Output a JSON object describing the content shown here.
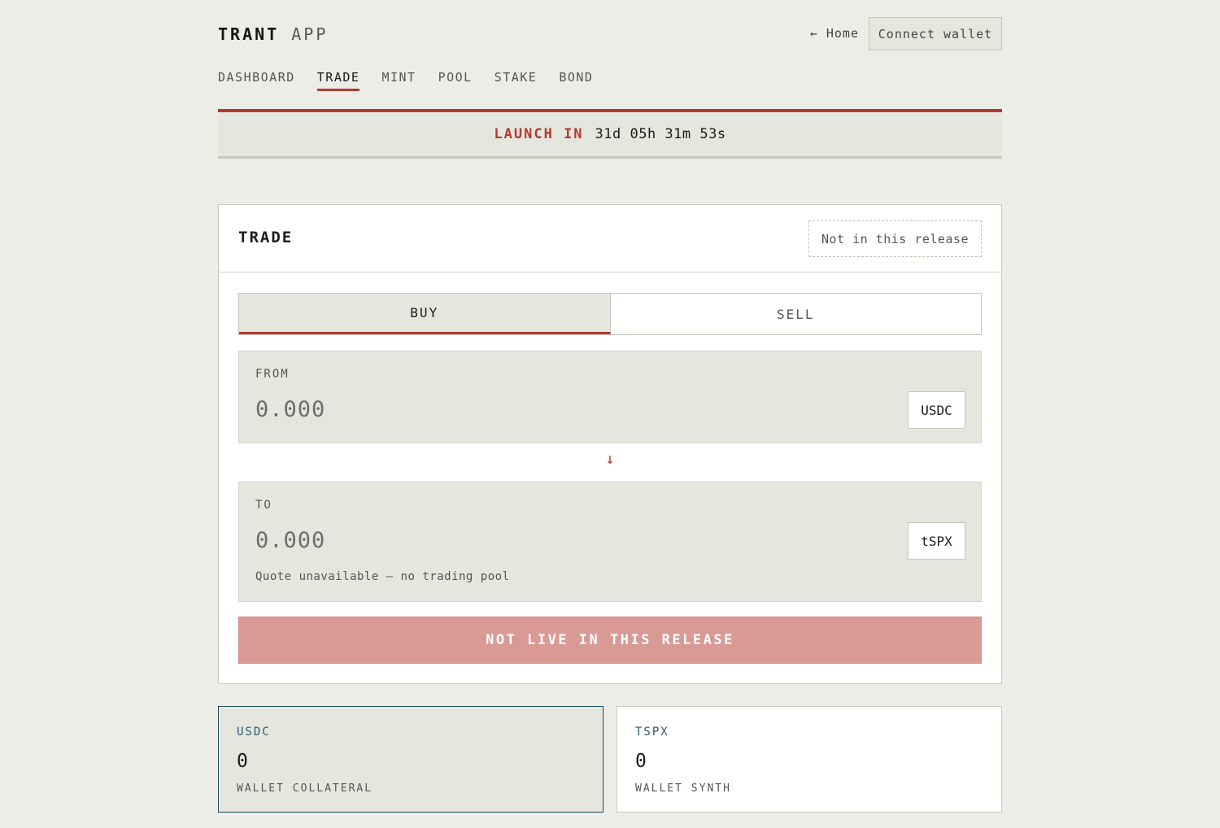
{
  "header": {
    "brand_primary": "TRANT",
    "brand_secondary": "APP",
    "home_link": "← Home",
    "connect_wallet": "Connect wallet"
  },
  "nav": {
    "items": [
      {
        "label": "DASHBOARD"
      },
      {
        "label": "TRADE",
        "active": true
      },
      {
        "label": "MINT"
      },
      {
        "label": "POOL"
      },
      {
        "label": "STAKE"
      },
      {
        "label": "BOND"
      }
    ]
  },
  "banner": {
    "label": "LAUNCH IN",
    "countdown": "31d 05h 31m 53s"
  },
  "trade": {
    "title": "TRADE",
    "release_tag": "Not in this release",
    "tabs": [
      {
        "label": "BUY",
        "active": true
      },
      {
        "label": "SELL"
      }
    ],
    "from": {
      "label": "FROM",
      "placeholder": "0.000",
      "token": "USDC"
    },
    "to": {
      "label": "TO",
      "placeholder": "0.000",
      "token": "tSPX",
      "note": "Quote unavailable — no trading pool"
    },
    "arrow_icon": "arrow-down-icon",
    "cta": "NOT LIVE IN THIS RELEASE"
  },
  "balances": [
    {
      "symbol": "USDC",
      "value": "0",
      "caption": "WALLET COLLATERAL"
    },
    {
      "symbol": "TSPX",
      "value": "0",
      "caption": "WALLET SYNTH"
    }
  ],
  "colors": {
    "accent": "#b23a2e",
    "background": "#ecede7",
    "panel": "#e5e7de",
    "cta_disabled": "#d99994",
    "tile_highlight": "#1f4a5e"
  }
}
